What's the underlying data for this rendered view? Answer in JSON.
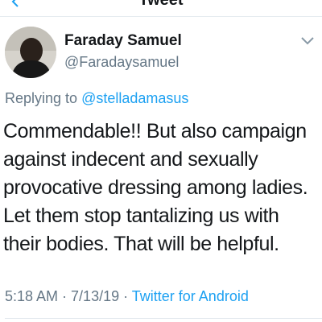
{
  "header": {
    "title": "Tweet"
  },
  "tweet": {
    "author_name": "Faraday Samuel",
    "author_handle": "@Faradaysamuel",
    "replying_prefix": "Replying to ",
    "replying_to": "@stelladamasus",
    "text": "Commendable!! But also campaign\nagainst indecent and sexually\nprovocative dressing among ladies.\nLet them stop tantalizing us with\ntheir bodies. That will be helpful.",
    "time": "5:18 AM",
    "date": "7/13/19",
    "separator": " · ",
    "source": "Twitter for Android"
  },
  "icons": {
    "back": "arrow-left-icon",
    "more": "chevron-down-icon"
  },
  "colors": {
    "text": "#14171a",
    "secondary": "#657786",
    "accent": "#1da1f2",
    "divider": "#e1e8ed"
  }
}
